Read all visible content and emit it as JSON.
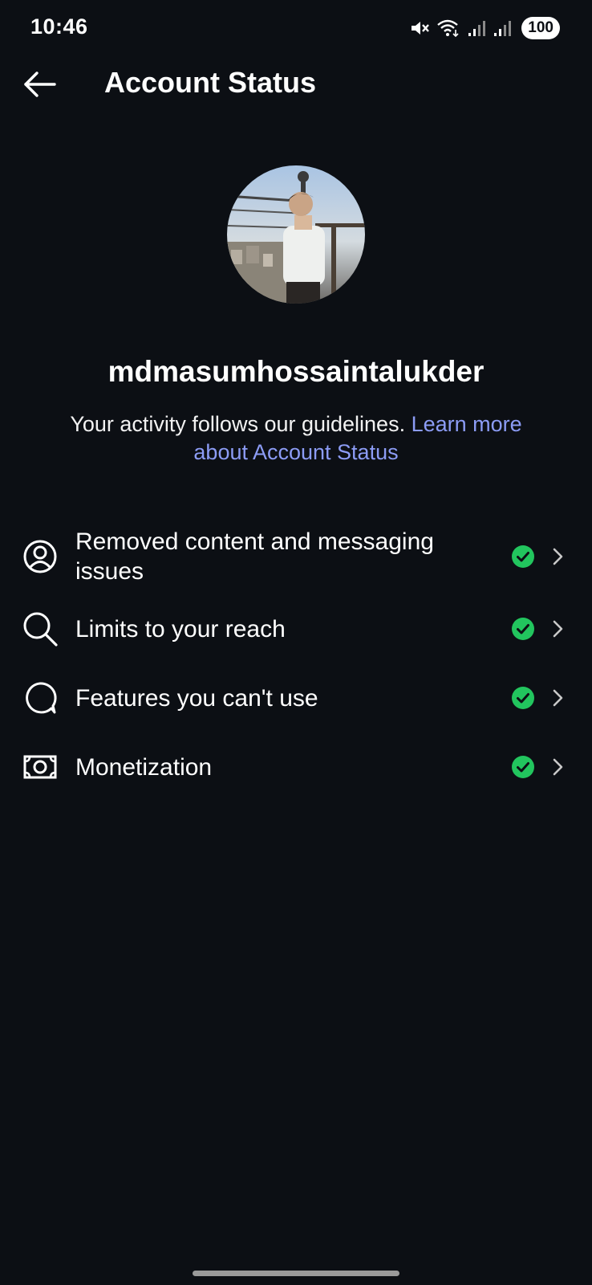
{
  "status_bar": {
    "time": "10:46",
    "battery": "100",
    "icons": [
      "mute-icon",
      "wifi-icon",
      "signal-icon",
      "signal-icon"
    ]
  },
  "header": {
    "title": "Account Status",
    "back_icon": "arrow-left-icon"
  },
  "profile": {
    "username": "mdmasumhossaintalukder",
    "guideline_text": "Your activity follows our guidelines. ",
    "learn_more_link": "Learn more about Account Status"
  },
  "menu": {
    "items": [
      {
        "label": "Removed content and messaging issues",
        "icon": "user-circle-icon",
        "status": "ok"
      },
      {
        "label": "Limits to your reach",
        "icon": "search-icon",
        "status": "ok"
      },
      {
        "label": "Features you can't use",
        "icon": "speech-bubble-icon",
        "status": "ok"
      },
      {
        "label": "Monetization",
        "icon": "money-icon",
        "status": "ok"
      }
    ]
  },
  "colors": {
    "background": "#0c0f14",
    "text": "#ffffff",
    "link": "#8c9cf5",
    "status_ok": "#22c55e"
  }
}
